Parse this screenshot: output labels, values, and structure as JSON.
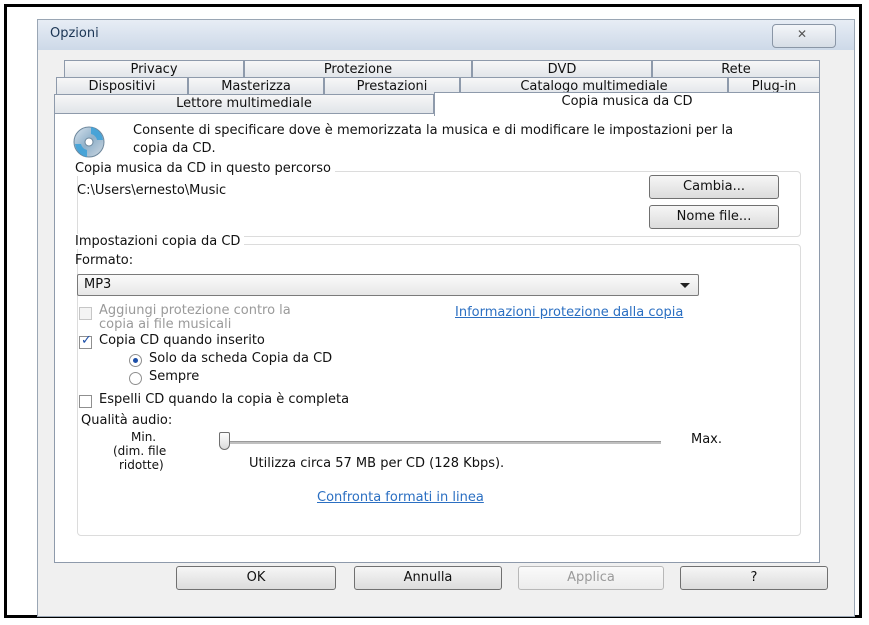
{
  "window": {
    "title": "Opzioni",
    "close_label": "✕"
  },
  "tabs": {
    "row1": [
      "Privacy",
      "Protezione",
      "DVD",
      "Rete"
    ],
    "row2": [
      "Dispositivi",
      "Masterizza",
      "Prestazioni",
      "Catalogo multimediale",
      "Plug-in"
    ],
    "row3": [
      "Lettore multimediale",
      "Copia musica da CD"
    ]
  },
  "panel": {
    "description": "Consente di specificare dove è memorizzata la musica e di modificare le impostazioni per la copia da CD.",
    "path_group": {
      "label": "Copia musica da CD in questo percorso",
      "path": "C:\\Users\\ernesto\\Music",
      "change_button": "Cambia...",
      "filename_button": "Nome file..."
    },
    "settings_group": {
      "label": "Impostazioni copia da CD",
      "format_label": "Formato:",
      "format_value": "MP3",
      "protection_checkbox": "Aggiungi protezione contro la copia ai file musicali",
      "protection_line1": "Aggiungi protezione contro la",
      "protection_line2": "copia ai file musicali",
      "protection_link": "Informazioni protezione dalla copia",
      "rip_on_insert": "Copia CD quando inserito",
      "rip_on_insert_checked": true,
      "radio_only_tab": "Solo da scheda Copia da CD",
      "radio_always": "Sempre",
      "radio_selected": "only_tab",
      "eject": "Espelli CD quando la copia è completa",
      "eject_checked": false,
      "quality_label": "Qualità audio:",
      "min_line1": "Min.",
      "min_line2": "(dim. file",
      "min_line3": "ridotte)",
      "max_label": "Max.",
      "quality_info": "Utilizza circa 57 MB per CD (128 Kbps).",
      "quality_level": 0,
      "compare_link": "Confronta formati in linea"
    }
  },
  "buttons": {
    "ok": "OK",
    "cancel": "Annulla",
    "apply": "Applica",
    "help": "?"
  },
  "colors": {
    "link": "#2b6fc2",
    "accent": "#1d4fa8"
  }
}
